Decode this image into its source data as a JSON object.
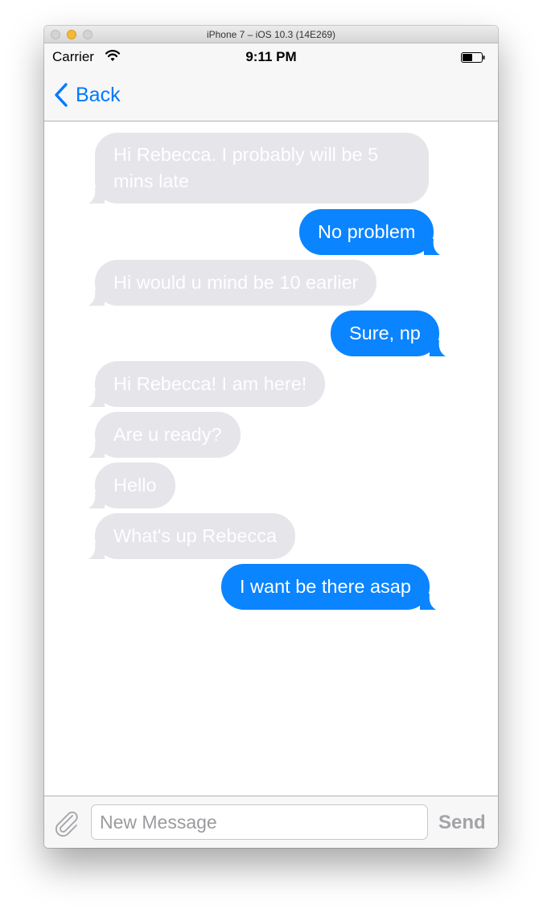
{
  "window": {
    "title": "iPhone 7 – iOS 10.3 (14E269)"
  },
  "statusbar": {
    "carrier": "Carrier",
    "time": "9:11 PM",
    "wifi_icon": "wifi-icon",
    "battery_icon": "battery-icon"
  },
  "navbar": {
    "back_label": "Back",
    "back_icon": "chevron-left-icon"
  },
  "messages": [
    {
      "direction": "incoming",
      "text": "Hi Rebecca. I probably will be 5 mins late"
    },
    {
      "direction": "outgoing",
      "text": "No problem"
    },
    {
      "direction": "incoming",
      "text": "Hi would u mind be 10 earlier"
    },
    {
      "direction": "outgoing",
      "text": "Sure, np"
    },
    {
      "direction": "incoming",
      "text": "Hi Rebecca! I am here!"
    },
    {
      "direction": "incoming",
      "text": "Are u ready?"
    },
    {
      "direction": "incoming",
      "text": "Hello"
    },
    {
      "direction": "incoming",
      "text": "What's up Rebecca"
    },
    {
      "direction": "outgoing",
      "text": "I want be there asap"
    }
  ],
  "inputbar": {
    "placeholder": "New Message",
    "value": "",
    "send_label": "Send",
    "attach_icon": "paperclip-icon"
  },
  "colors": {
    "incoming_bubble": "#e5e5ea",
    "outgoing_bubble": "#0a84ff",
    "accent": "#007aff",
    "send_disabled": "#a3a3a8"
  }
}
